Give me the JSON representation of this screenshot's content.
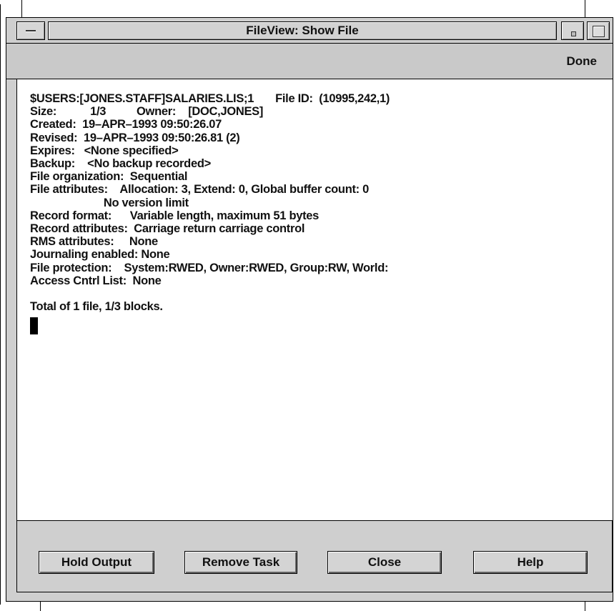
{
  "window": {
    "title": "FileView: Show File"
  },
  "menubar": {
    "done_label": "Done"
  },
  "output": {
    "lines": [
      "$USERS:[JONES.STAFF]SALARIES.LIS;1       File ID:  (10995,242,1)",
      "Size:           1/3          Owner:    [DOC,JONES]",
      "Created:  19–APR–1993 09:50:26.07",
      "Revised:  19–APR–1993 09:50:26.81 (2)",
      "Expires:   <None specified>",
      "Backup:    <No backup recorded>",
      "File organization:  Sequential",
      "File attributes:    Allocation: 3, Extend: 0, Global buffer count: 0",
      "                        No version limit",
      "Record format:      Variable length, maximum 51 bytes",
      "Record attributes:  Carriage return carriage control",
      "RMS attributes:     None",
      "Journaling enabled: None",
      "File protection:    System:RWED, Owner:RWED, Group:RW, World:",
      "Access Cntrl List:  None",
      "",
      "Total of 1 file, 1/3 blocks."
    ]
  },
  "buttons": {
    "hold_output": "Hold Output",
    "remove_task": "Remove Task",
    "close": "Close",
    "help": "Help"
  }
}
